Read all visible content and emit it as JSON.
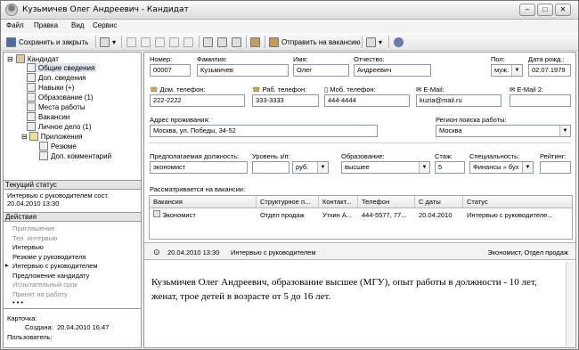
{
  "window": {
    "title": "Кузьмичев Олег Андреевич - Кандидат",
    "min": "–",
    "max": "□",
    "close": "✕"
  },
  "menu": [
    "Файл",
    "Правка",
    "Вид",
    "Сервис"
  ],
  "toolbar": {
    "save_close": "Сохранить и закрыть",
    "send": "Отправить на вакансию"
  },
  "tree": {
    "root": "Кандидат",
    "items": [
      "Общие сведения",
      "Доп. сведения",
      "Навыки (+)",
      "Образование (1)",
      "Места работы",
      "Вакансии",
      "Личное дело (1)",
      "Приложения",
      "Резюме",
      "Доп. комментарий"
    ]
  },
  "status": {
    "label": "Текущий статус",
    "text1": "Интервью с руководителем сост.",
    "text2": "20.04.2010 13:30"
  },
  "actions": {
    "label": "Действия",
    "items": [
      {
        "t": "Приглашение",
        "dis": true
      },
      {
        "t": "Тел. интервью",
        "dis": true
      },
      {
        "t": "Интервью",
        "dis": false
      },
      {
        "t": "Резюме у руководителя",
        "dis": false
      },
      {
        "t": "Интервью с руководителем",
        "dis": false
      },
      {
        "t": "Предложение кандидату",
        "dis": false
      },
      {
        "t": "Испытательный срок",
        "dis": true
      },
      {
        "t": "Принят на работу",
        "dis": true
      }
    ],
    "more": "• • •"
  },
  "card": {
    "label": "Карточка:",
    "created_label": "Создана:",
    "created": "20.04.2010 16:47",
    "user_label": "Пользователь:"
  },
  "form": {
    "number_label": "Номер:",
    "number": "00007",
    "last_label": "Фамилия:",
    "last": "Кузьмичев",
    "first_label": "Имя:",
    "first": "Олег",
    "middle_label": "Отчество:",
    "middle": "Андреевич",
    "sex_label": "Пол:",
    "sex": "муж.",
    "dob_label": "Дата рожд.:",
    "dob": "02.07.1979",
    "home_label": "Дом. телефон:",
    "home": "222-2222",
    "work_label": "Раб. телефон:",
    "work": "333-3333",
    "mob_label": "Моб. телефон:",
    "mob": "444-4444",
    "email_label": "E-Mail:",
    "email": "kuzia@mail.ru",
    "email2_label": "E-Mail 2:",
    "email2": "",
    "addr_label": "Адрес проживания:",
    "addr": "Москва, ул. Победы,  34-52",
    "region_label": "Регион поиска работы:",
    "region": "Москва",
    "pos_label": "Предполагаемая должность:",
    "pos": "экономист",
    "salary_label": "Уровень з/п:",
    "salary": "",
    "cur": "руб.",
    "edu_label": "Образование:",
    "edu": "высшее",
    "exp_label": "Стаж:",
    "exp": "5",
    "spec_label": "Специальность:",
    "spec": "Финансы  »  бух",
    "rating_label": "Рейтинг:",
    "rating": ""
  },
  "vacancies": {
    "label": "Рассматривается на вакансии:",
    "headers": [
      "Вакансия",
      "Структурное п...",
      "Контакт...",
      "Телефон",
      "С даты",
      "Статус"
    ],
    "rows": [
      [
        "Экономист",
        "Отдел продаж",
        "Уткин А...",
        "444-5577,  77...",
        "20.04.2010",
        "Интервью с руководителе..."
      ]
    ]
  },
  "history": {
    "datetime": "20.04.2010  13:30",
    "status": "Интервью с руководителем",
    "right": "Экономист,  Отдел продаж"
  },
  "note": "Кузьмичев Олег Андреевич, образование высшее (МГУ), опыт работы в должности - 10 лет, женат, трое детей в возрасте от 5 до 16 лет."
}
